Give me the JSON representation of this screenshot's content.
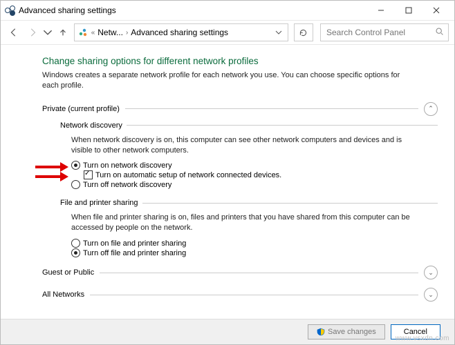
{
  "window": {
    "title": "Advanced sharing settings"
  },
  "nav": {
    "crumb1": "Netw...",
    "crumb2": "Advanced sharing settings",
    "search_placeholder": "Search Control Panel"
  },
  "main": {
    "heading": "Change sharing options for different network profiles",
    "intro": "Windows creates a separate network profile for each network you use. You can choose specific options for each profile."
  },
  "private": {
    "title": "Private (current profile)",
    "discovery": {
      "title": "Network discovery",
      "desc": "When network discovery is on, this computer can see other network computers and devices and is visible to other network computers.",
      "on": "Turn on network discovery",
      "auto": "Turn on automatic setup of network connected devices.",
      "off": "Turn off network discovery"
    },
    "fps": {
      "title": "File and printer sharing",
      "desc": "When file and printer sharing is on, files and printers that you have shared from this computer can be accessed by people on the network.",
      "on": "Turn on file and printer sharing",
      "off": "Turn off file and printer sharing"
    }
  },
  "guest": {
    "title": "Guest or Public"
  },
  "all": {
    "title": "All Networks"
  },
  "footer": {
    "save": "Save changes",
    "cancel": "Cancel"
  },
  "watermark": "www.vsxdn.com"
}
